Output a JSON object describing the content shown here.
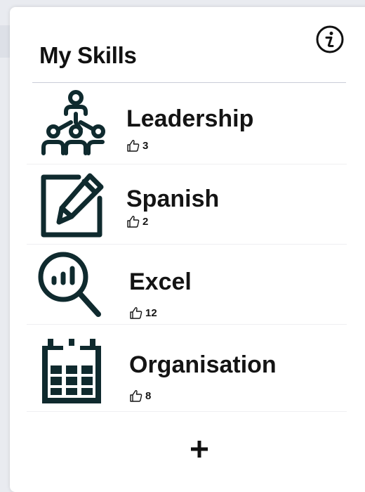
{
  "panel": {
    "title": "My Skills",
    "info_icon": "info-icon",
    "add_icon": "plus-icon"
  },
  "colors": {
    "icon": "#0f2a2e",
    "text": "#141414",
    "divider": "#c9ccd8"
  },
  "skills": [
    {
      "name": "Leadership",
      "endorsements": "3",
      "icon": "team-hierarchy-icon",
      "endorse_icon": "thumbs-up-icon"
    },
    {
      "name": "Spanish",
      "endorsements": "2",
      "icon": "edit-document-icon",
      "endorse_icon": "thumbs-up-icon"
    },
    {
      "name": "Excel",
      "endorsements": "12",
      "icon": "chart-search-icon",
      "endorse_icon": "thumbs-up-icon"
    },
    {
      "name": "Organisation",
      "endorsements": "8",
      "icon": "calendar-icon",
      "endorse_icon": "thumbs-up-icon"
    }
  ]
}
